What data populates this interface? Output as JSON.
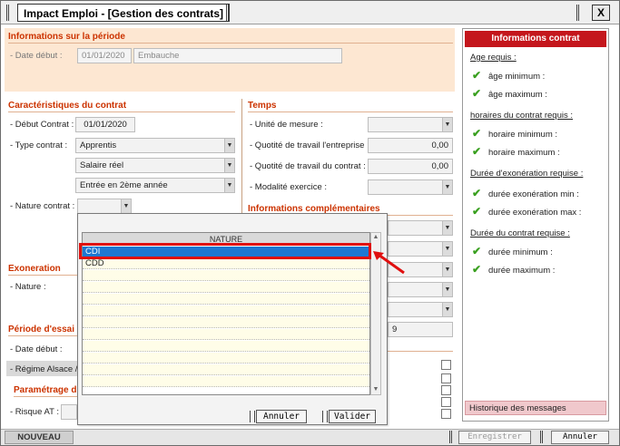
{
  "window": {
    "title": "Impact Emploi - [Gestion des contrats]",
    "close_label": "X"
  },
  "periode": {
    "title": "Informations sur la période",
    "date_debut_label": "- Date début :",
    "date_debut_value": "01/01/2020",
    "motif_value": "Embauche"
  },
  "caracteristiques": {
    "title": "Caractéristiques du contrat",
    "debut_label": "- Début Contrat :",
    "debut_value": "01/01/2020",
    "type_label": "- Type contrat :",
    "type_value": "Apprentis",
    "salaire_value": "Salaire réel",
    "annee_value": "Entrée en 2ème année",
    "nature_label": "- Nature contrat :"
  },
  "temps": {
    "title": "Temps",
    "unite_label": "- Unité de mesure :",
    "quotite_entreprise_label": "- Quotité de travail l'entreprise :",
    "quotite_entreprise_value": "0,00",
    "quotite_contrat_label": "- Quotité de travail du contrat :",
    "quotite_contrat_value": "0,00",
    "modalite_label": "- Modalité exercice :"
  },
  "infos_complementaires": {
    "title": "Informations complémentaires",
    "partial_value": "9"
  },
  "exoneration": {
    "title": "Exoneration",
    "nature_label": "- Nature :"
  },
  "essai": {
    "title": "Période d'essai",
    "date_label": "- Date début :",
    "regime_label": "- Régime Alsace /"
  },
  "parametrage": {
    "title": "Paramétrage d",
    "risque_label": "- Risque AT :"
  },
  "right_panel": {
    "title": "Informations contrat",
    "age_group": "Age requis :",
    "age_min": "âge minimum :",
    "age_max": "âge maximum :",
    "horaires_group": "horaires du contrat requis :",
    "horaire_min": "horaire minimum :",
    "horaire_max": "horaire maximum :",
    "exo_group": "Durée d'exonération requise :",
    "exo_min": "durée exonération min :",
    "exo_max": "durée exonération max :",
    "duree_group": "Durée du contrat requise :",
    "duree_min": "durée minimum :",
    "duree_max": "durée maximum :",
    "history": "Historique des messages"
  },
  "popup": {
    "header": "NATURE",
    "items": [
      "CDI",
      "CDD"
    ],
    "selected": "CDI",
    "cancel_label": "Annuler",
    "validate_label": "Valider"
  },
  "bottombar": {
    "new_label": "NOUVEAU",
    "save_label": "Enregistrer",
    "cancel_label": "Annuler"
  },
  "colors": {
    "accent_red": "#c4161c",
    "section_title": "#cc3300",
    "band_bg": "#fde7d2",
    "selection_blue": "#1e78d2",
    "tick_green": "#3aa020"
  }
}
